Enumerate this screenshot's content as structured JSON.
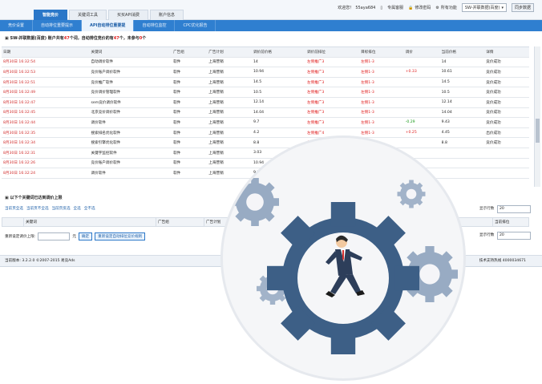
{
  "header": {
    "tabs": [
      "智能竞价",
      "关键词工具",
      "买买API消费",
      "账户信息"
    ],
    "welcome": "欢迎您！",
    "username": "55aya684",
    "links": [
      "专属客服",
      "修改密码",
      "所有功能"
    ],
    "account_select": "SW-并联数据(百度)",
    "sync_button": "同步数据"
  },
  "subnav": [
    "竞价设置",
    "自动排位重要提示",
    "API自动排位重要提",
    "自动排位监控",
    "CPC优化报告"
  ],
  "account_summary": {
    "prefix": "SW-并联数据(百度) 账户共有",
    "total": "47",
    "mid1": "个词，自动排位竞价的有",
    "auto": "47",
    "mid2": "个，未参与",
    "none": "0",
    "suffix": "个"
  },
  "table": {
    "headers": [
      "日期",
      "关键词",
      "广告组",
      "广告计划",
      "调价前价格",
      "调价前排位",
      "目标排位",
      "调价",
      "当前价格",
      "详情"
    ],
    "rows": [
      [
        "8月30日 16:32:54",
        "自动调价软件",
        "软件",
        "上海营销",
        "14",
        "左侧推广3",
        "左侧1-3",
        "",
        "14",
        "竞价成功"
      ],
      [
        "8月30日 16:32:53",
        "竞价账户调价软件",
        "软件",
        "上海营销",
        "10.94",
        "左侧推广3",
        "左侧1-3",
        "+0.33",
        "10.61",
        "竞价成功"
      ],
      [
        "8月30日 16:32:51",
        "竞价推广软件",
        "软件",
        "上海营销",
        "14.5",
        "左侧推广3",
        "左侧1-3",
        "",
        "14.5",
        "竞价成功"
      ],
      [
        "8月30日 16:32:49",
        "竞价调价管理软件",
        "软件",
        "上海营销",
        "10.5",
        "左侧推广3",
        "左侧1-3",
        "",
        "10.5",
        "竞价成功"
      ],
      [
        "8月30日 16:32:47",
        "sem竞价调价软件",
        "软件",
        "上海营销",
        "12.14",
        "左侧推广3",
        "左侧1-3",
        "",
        "12.14",
        "竞价成功"
      ],
      [
        "8月30日 16:32:45",
        "北京竞价调价软件",
        "软件",
        "上海营销",
        "14.04",
        "左侧推广3",
        "左侧1-3",
        "",
        "14.04",
        "竞价成功"
      ],
      [
        "8月30日 16:32:44",
        "调价软件",
        "软件",
        "上海营销",
        "9.7",
        "左侧推广3",
        "左侧1-3",
        "-0.29",
        "9.43",
        "竞价成功"
      ],
      [
        "8月30日 16:32:35",
        "搜索排名优化软件",
        "软件",
        "上海营销",
        "4.2",
        "左侧推广4",
        "左侧1-3",
        "+0.25",
        "4.45",
        "出价成功"
      ],
      [
        "8月30日 16:32:34",
        "搜索引擎优化软件",
        "软件",
        "上海营销",
        "8.8",
        "左侧推广3",
        "左侧1-3",
        "",
        "8.8",
        "竞价成功"
      ],
      [
        "8月30日 16:32:31",
        "关键字监控软件",
        "软件",
        "上海营销",
        "3.03",
        "左侧推广3",
        "左侧1-3",
        "",
        "",
        ""
      ],
      [
        "8月30日 16:32:26",
        "竞价账户调价软件",
        "软件",
        "上海营销",
        "10.94",
        "左侧推广3",
        "左侧1-3",
        "",
        "",
        ""
      ],
      [
        "8月30日 16:32:24",
        "调价软件",
        "软件",
        "上海营销",
        "9.7",
        "左侧推广3",
        "左侧1-3",
        "",
        "",
        ""
      ]
    ]
  },
  "section2": {
    "title": "以下个关键词已达到调价上限",
    "links": [
      "当前页全选",
      "当前页不全选",
      "当前页反选",
      "全选",
      "全不选"
    ],
    "rows_label": "显示行数",
    "rows_value": "20",
    "headers": [
      "关键词",
      "广告组",
      "广告计划",
      "地域",
      "当前排位"
    ],
    "reset_label": "重新设定调价上限:",
    "unit": "元",
    "confirm": "确定",
    "reset_button": "重新设定自动排位竞价规则",
    "rows_label2": "显示行数",
    "rows_value2": "20"
  },
  "status": {
    "version": "当前版本: 3.2.2.0 ©2007-2015 易竞Ads",
    "support": "技术支持热线 4000034671"
  },
  "colors": {
    "primary": "#2f7fd0",
    "red": "#e02020",
    "gear": "#3d5f86",
    "gear_light": "#7d95b3"
  }
}
